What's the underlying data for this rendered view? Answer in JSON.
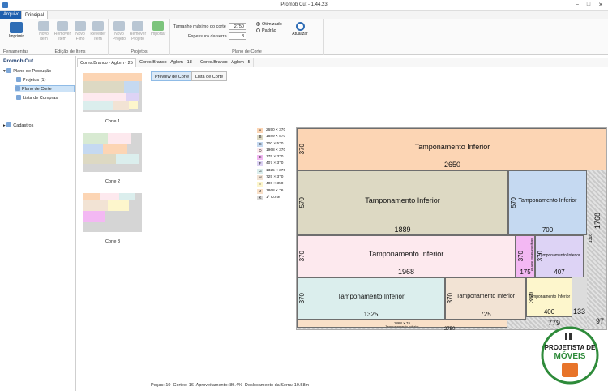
{
  "window": {
    "title": "Promob Cut - 1.44.23"
  },
  "ribbon_tabs": {
    "file": "Arquivo",
    "main": "Principal"
  },
  "ribbon": {
    "print": "Imprimir",
    "grp_tools": "Ferramentas",
    "new_item": "Novo Item",
    "remove_item": "Remover Item",
    "new_child": "Novo Filho",
    "reverse_item": "Reverter Item",
    "grp_edit": "Edição de Itens",
    "new_project": "Novo Projeto",
    "remove_project": "Remover Projeto",
    "import": "Importar",
    "grp_projects": "Projetos",
    "max_cut_label": "Tamanho máximo do corte",
    "max_cut_value": "2750",
    "saw_label": "Espessura da serra",
    "saw_value": "3",
    "grp_plan": "Plano de Corte",
    "opt_optimized": "Otimizado",
    "opt_default": "Padrão",
    "refresh": "Atualizar"
  },
  "sidebar": {
    "title": "Promob Cut",
    "items": [
      "Plano de Produção",
      "Projetos (1)",
      "Plano de Corte",
      "Lista de Compras",
      "Cadastros"
    ]
  },
  "doc_tabs": [
    "Cores.Branco - Aglom - 25",
    "Cores.Branco - Aglom - 18",
    "Cores.Branco - Aglom - 5"
  ],
  "thumbs": [
    "Corte 1",
    "Corte 2",
    "Corte 3"
  ],
  "view_buttons": {
    "preview": "Preview de Corte",
    "list": "Lista de Corte"
  },
  "legend": [
    {
      "id": "A",
      "text": "2650 × 370",
      "color": "#fcd5b4"
    },
    {
      "id": "B",
      "text": "1889 × 570",
      "color": "#ddd9c3"
    },
    {
      "id": "C",
      "text": "700 × 570",
      "color": "#c5d9f1"
    },
    {
      "id": "D",
      "text": "1968 × 370",
      "color": "#fde9ee"
    },
    {
      "id": "E",
      "text": "175 × 370",
      "color": "#f3b8f3"
    },
    {
      "id": "F",
      "text": "407 × 370",
      "color": "#ddd3f5"
    },
    {
      "id": "G",
      "text": "1325 × 370",
      "color": "#dbeeed"
    },
    {
      "id": "H",
      "text": "725 × 370",
      "color": "#f2e3d4"
    },
    {
      "id": "I",
      "text": "400 × 350",
      "color": "#fdf6cc"
    },
    {
      "id": "J",
      "text": "1868 × 76",
      "color": "#f9e0c8"
    },
    {
      "id": "K",
      "text": "1º Corte",
      "color": "#d9d9d9"
    }
  ],
  "pieces": [
    {
      "name": "Tamponamento Inferior",
      "w": "2650",
      "h": "370",
      "color": "#fcd5b4"
    },
    {
      "name": "Tamponamento Inferior",
      "w": "1889",
      "h": "570",
      "color": "#ddd9c3"
    },
    {
      "name": "Tamponamento Inferior",
      "w": "700",
      "h": "570",
      "color": "#c5d9f1"
    },
    {
      "name": "Tamponamento Inferior",
      "w": "1968",
      "h": "370",
      "color": "#fde9ee"
    },
    {
      "name": "Tamponamento Inferior",
      "w": "175",
      "h": "370",
      "color": "#f3b8f3"
    },
    {
      "name": "Tamponamento Inferior",
      "w": "407",
      "h": "370",
      "color": "#ddd3f5"
    },
    {
      "name": "Tamponamento Inferior",
      "w": "1325",
      "h": "370",
      "color": "#dbeeed"
    },
    {
      "name": "Tamponamento Inferior",
      "w": "725",
      "h": "370",
      "color": "#f2e3d4"
    },
    {
      "name": "Tamponamento Inferior",
      "w": "400",
      "h": "350",
      "color": "#fdf6cc"
    },
    {
      "name": "Tamponamento Inferior",
      "w": "1868 × 76",
      "h": "",
      "color": "#f9e0c8"
    }
  ],
  "board_dims": {
    "height": "1768",
    "width": "2750",
    "right_rest": "97",
    "w779": "779",
    "w133": "133",
    "h1316": "1316"
  },
  "status": {
    "pieces": "Peças: 10",
    "cuts": "Cortes: 16",
    "usage": "Aproveitamento: 89.4%",
    "saw": "Deslocamento da Serra: 19.58m"
  },
  "logo": {
    "line1": "PROJETISTA DE",
    "line2": "MÓVEIS"
  }
}
